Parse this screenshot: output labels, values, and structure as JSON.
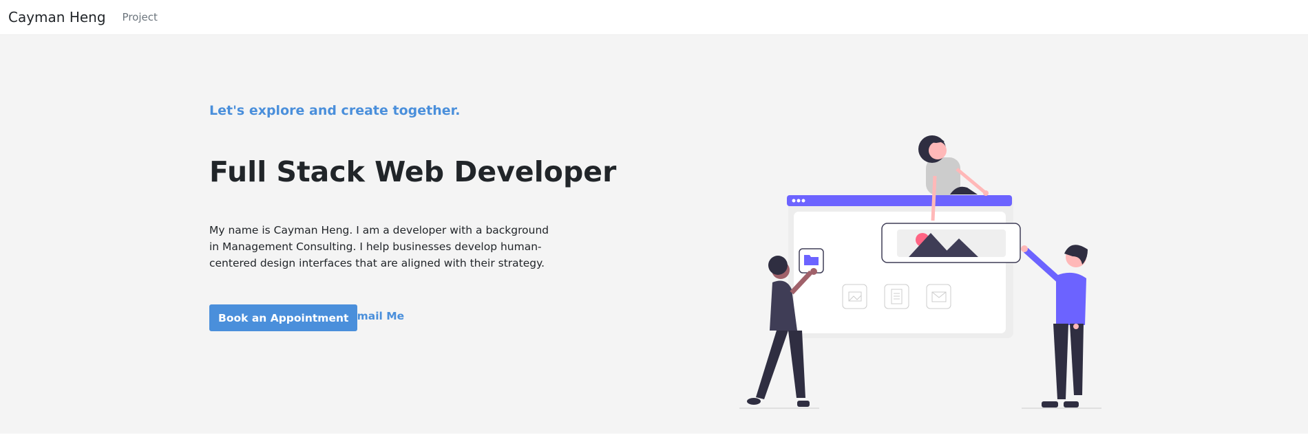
{
  "navbar": {
    "brand": "Cayman Heng",
    "links": [
      {
        "label": "Project"
      }
    ]
  },
  "hero": {
    "tagline": "Let's explore and create together.",
    "title": "Full Stack Web Developer",
    "description": "My name is Cayman Heng. I am a developer with a background in Management Consulting. I help businesses develop human-centered design interfaces that are aligned with their strategy.",
    "primary_button": "Book an Appointment",
    "secondary_link": "Email Me"
  },
  "colors": {
    "accent": "#4a8fdb",
    "illustration_purple": "#6c63ff",
    "hero_background": "#f4f4f4",
    "dark_figure": "#2f2e41",
    "skin_tone": "#ffb8b8",
    "highlight_pink": "#ff6584"
  },
  "illustration": {
    "icons": [
      "folder-icon",
      "image-icon",
      "document-icon",
      "mail-icon",
      "mountain-image-icon"
    ]
  }
}
